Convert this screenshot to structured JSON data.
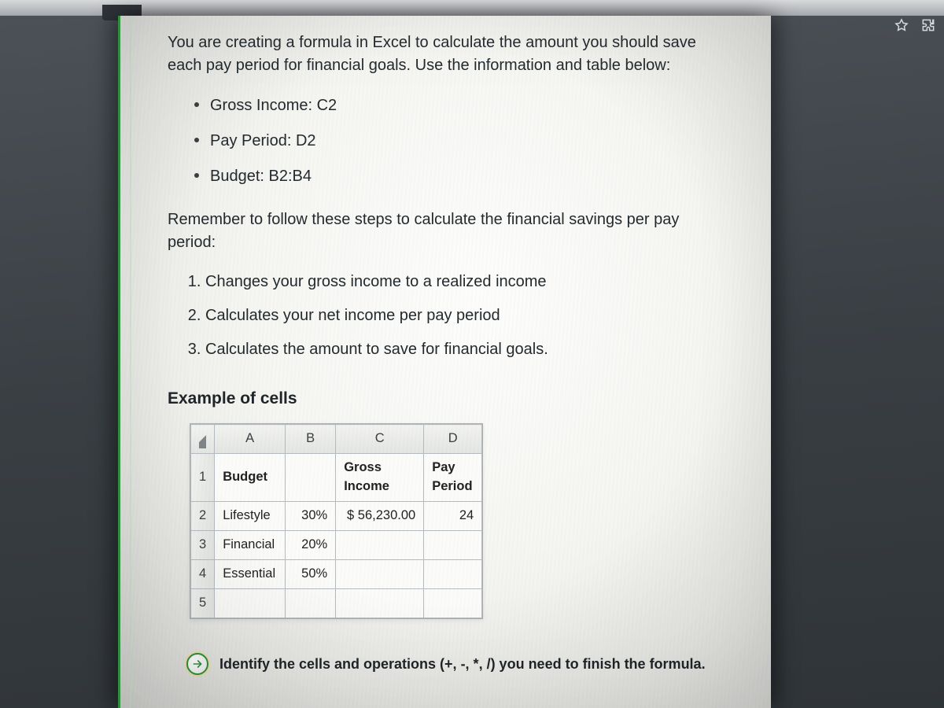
{
  "intro": "You are creating a formula in Excel to calculate the amount you should save each pay period for financial goals. Use the information and table below:",
  "bullets": {
    "b0": "Gross Income: C2",
    "b1": "Pay Period: D2",
    "b2": "Budget: B2:B4"
  },
  "remember": "Remember to follow these steps to calculate the financial savings per pay period:",
  "steps": {
    "s0": "Changes your gross income to a realized income",
    "s1": "Calculates your net income per pay period",
    "s2": "Calculates the amount to save for financial goals."
  },
  "example_heading": "Example of cells",
  "sheet": {
    "cols": {
      "A": "A",
      "B": "B",
      "C": "C",
      "D": "D"
    },
    "rows": {
      "r1": "1",
      "r2": "2",
      "r3": "3",
      "r4": "4",
      "r5": "5"
    },
    "cells": {
      "A1": "Budget",
      "C1a": "Gross",
      "C1b": "Income",
      "D1a": "Pay",
      "D1b": "Period",
      "A2": "Lifestyle",
      "B2": "30%",
      "C2": "$ 56,230.00",
      "D2": "24",
      "A3": "Financial",
      "B3": "20%",
      "A4": "Essential",
      "B4": "50%"
    }
  },
  "prompt": "Identify the cells and operations (+, -, *, /) you need to finish the formula."
}
